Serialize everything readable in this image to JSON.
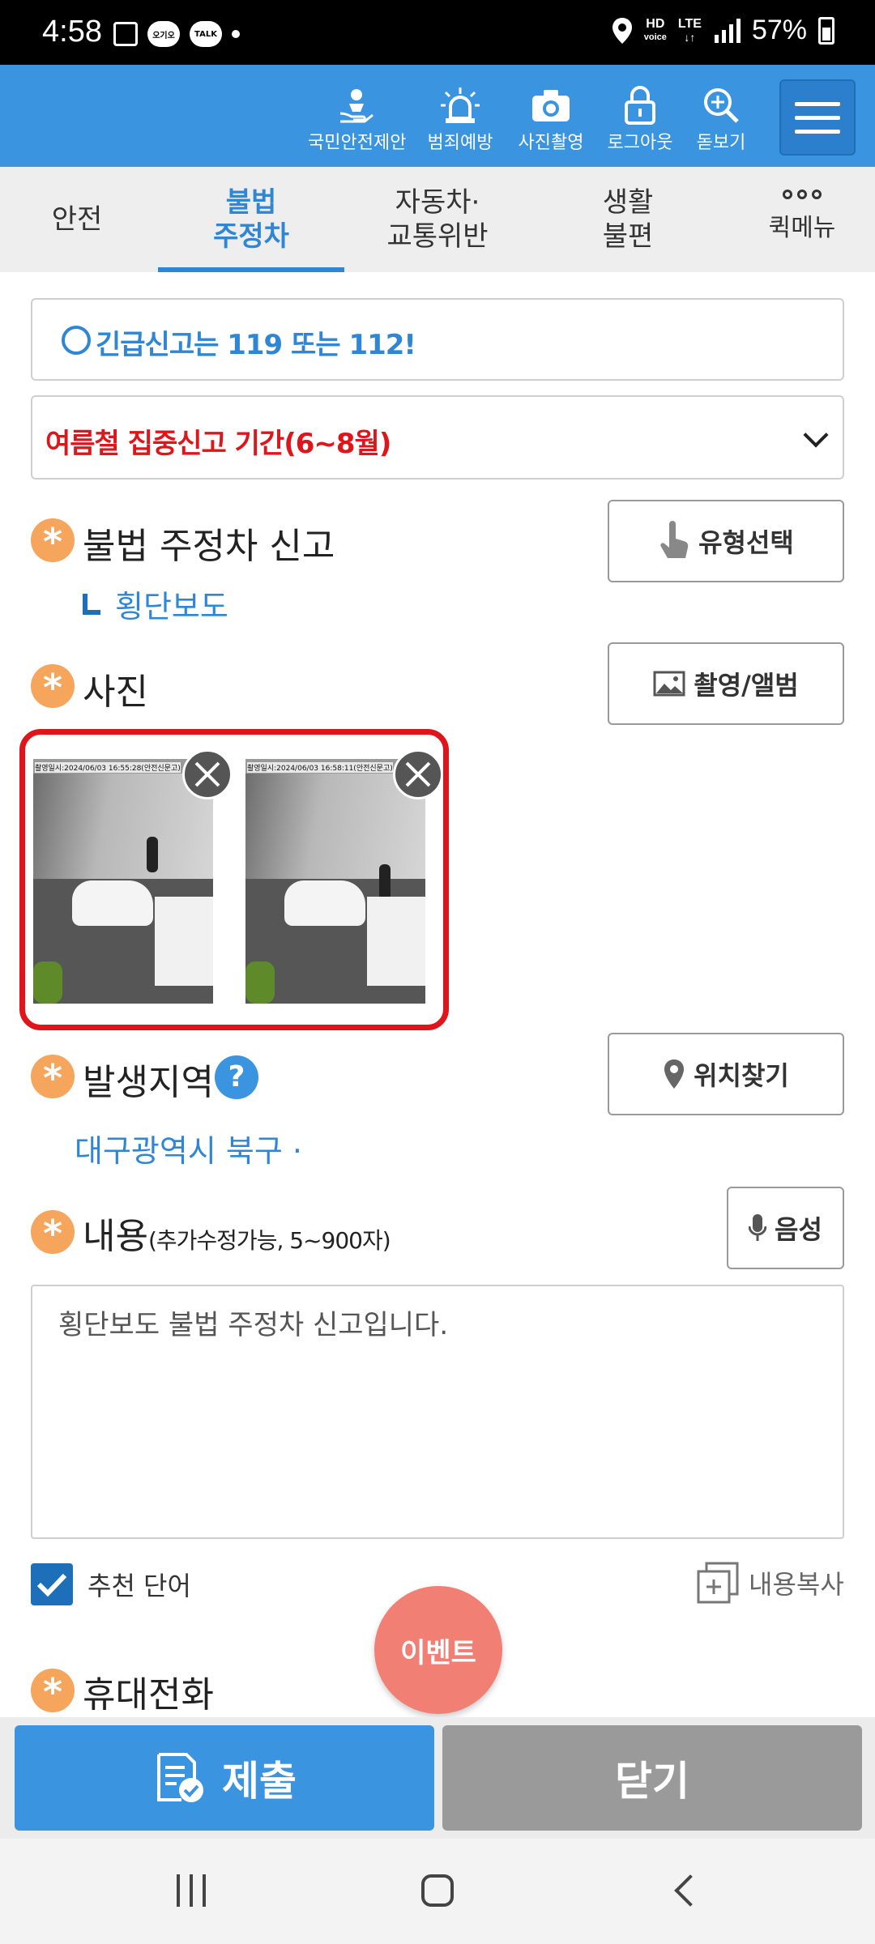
{
  "status_bar": {
    "time": "4:58",
    "chip1": "오기오",
    "chip2": "TALK",
    "hd_top": "HD",
    "hd_bottom": "voice",
    "lte": "LTE",
    "battery": "57%"
  },
  "toolbar": {
    "items": [
      {
        "label": "국민안전제안",
        "icon": "hand-person-icon"
      },
      {
        "label": "범죄예방",
        "icon": "siren-icon"
      },
      {
        "label": "사진촬영",
        "icon": "camera-icon"
      },
      {
        "label": "로그아웃",
        "icon": "lock-icon"
      },
      {
        "label": "돋보기",
        "icon": "zoom-icon"
      }
    ],
    "menu_icon": "hamburger-icon"
  },
  "tabs": {
    "items": [
      {
        "label": "안전"
      },
      {
        "label": "불법\n주정차",
        "active": true
      },
      {
        "label": "자동차·\n교통위반"
      },
      {
        "label": "생활\n불편"
      }
    ],
    "more_label": "퀵메뉴"
  },
  "notices": {
    "emergency": "긴급신고는 119 또는 112!",
    "summer": "여름철 집중신고 기간(6~8월)"
  },
  "report": {
    "title": "불법 주정차 신고",
    "type_button": "유형선택",
    "selected_type": "횡단보도"
  },
  "photo": {
    "title": "사진",
    "button": "촬영/앨범",
    "images": [
      {
        "caption": "촬영일시:2024/06/03 16:55:28(안전신문고)"
      },
      {
        "caption": "촬영일시:2024/06/03 16:58:11(안전신문고)"
      }
    ]
  },
  "location": {
    "title": "발생지역",
    "help": "?",
    "button": "위치찾기",
    "address": "대구광역시 북구 ·"
  },
  "content": {
    "title": "내용",
    "hint": "(추가수정가능, 5~900자)",
    "voice_button": "음성",
    "text": "횡단보도 불법 주정차 신고입니다."
  },
  "options": {
    "recommend_label": "추천 단어",
    "recommend_checked": true,
    "copy_label": "내용복사"
  },
  "event_button": "이벤트",
  "phone": {
    "title": "휴대전화"
  },
  "actions": {
    "submit": "제출",
    "close": "닫기"
  },
  "colors": {
    "primary": "#3a94e0",
    "alert_red": "#e0151b",
    "asterisk": "#f5a55c",
    "event": "#f27f73"
  }
}
